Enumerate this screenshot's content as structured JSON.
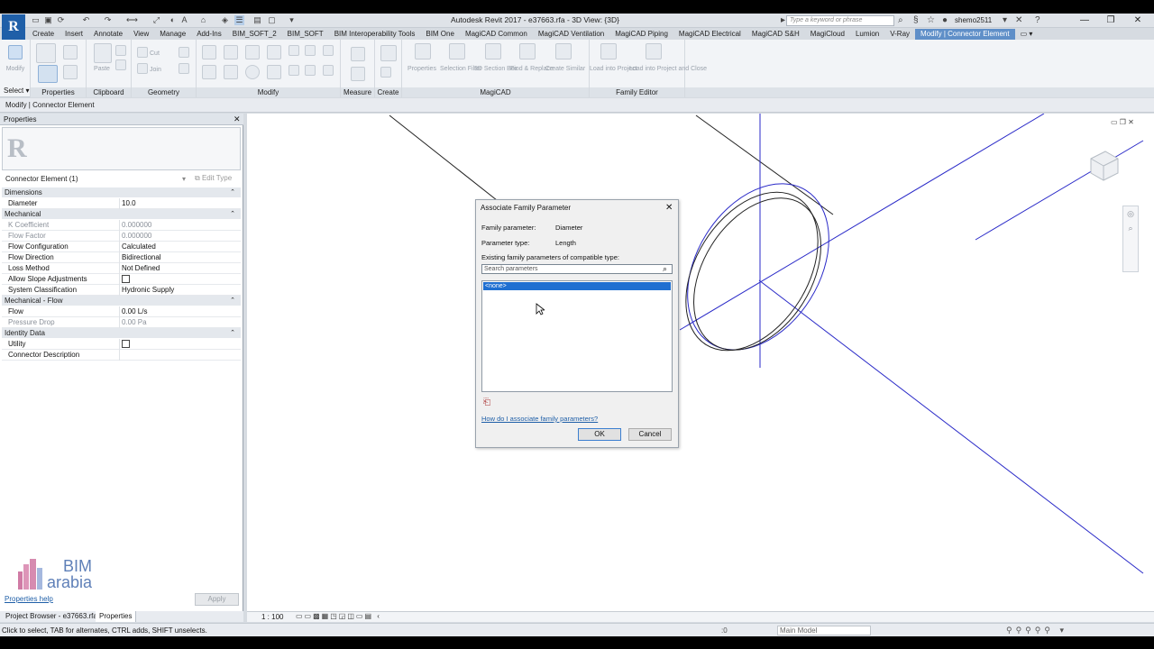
{
  "app": {
    "title": "Autodesk Revit 2017 -   e37663.rfa - 3D View: {3D}",
    "search_placeholder": "Type a keyword or phrase",
    "user": "shemo2511"
  },
  "tabs": [
    "Create",
    "Insert",
    "Annotate",
    "View",
    "Manage",
    "Add-Ins",
    "BIM_SOFT_2",
    "BIM_SOFT",
    "BIM Interoperability Tools",
    "BIM One",
    "MagiCAD Common",
    "MagiCAD Ventilation",
    "MagiCAD Piping",
    "MagiCAD Electrical",
    "MagiCAD S&H",
    "MagiCloud",
    "Lumion",
    "V-Ray",
    "Modify | Connector Element"
  ],
  "active_tab_index": 18,
  "ribbon": {
    "modify_label": "Modify",
    "select_label": "Select",
    "panels": [
      "Properties",
      "Clipboard",
      "Geometry",
      "Modify",
      "Measure",
      "Create",
      "MagiCAD",
      "Family Editor"
    ],
    "clipboard_paste": "Paste",
    "geometry_cut": "Cut",
    "geometry_join": "Join",
    "magicad_items": [
      "Properties",
      "Selection Filter",
      "3D Section Box",
      "Find & Replace",
      "Create Similar"
    ],
    "family_editor_items": [
      "Load into Project",
      "Load into Project and Close"
    ]
  },
  "options_bar": "Modify | Connector Element",
  "properties": {
    "title": "Properties",
    "instance": "Connector Element (1)",
    "edit_type": "Edit Type",
    "groups": [
      {
        "name": "Dimensions",
        "rows": [
          {
            "name": "Diameter",
            "value": "10.0",
            "dim": false
          }
        ]
      },
      {
        "name": "Mechanical",
        "rows": [
          {
            "name": "K Coefficient",
            "value": "0.000000",
            "dim": true
          },
          {
            "name": "Flow Factor",
            "value": "0.000000",
            "dim": true
          },
          {
            "name": "Flow Configuration",
            "value": "Calculated",
            "dim": false
          },
          {
            "name": "Flow Direction",
            "value": "Bidirectional",
            "dim": false
          },
          {
            "name": "Loss Method",
            "value": "Not Defined",
            "dim": false
          },
          {
            "name": "Allow Slope Adjustments",
            "value": "",
            "check": true,
            "dim": false
          },
          {
            "name": "System Classification",
            "value": "Hydronic Supply",
            "dim": false
          }
        ]
      },
      {
        "name": "Mechanical - Flow",
        "rows": [
          {
            "name": "Flow",
            "value": "0.00 L/s",
            "dim": false
          },
          {
            "name": "Pressure Drop",
            "value": "0.00 Pa",
            "dim": true
          }
        ]
      },
      {
        "name": "Identity Data",
        "rows": [
          {
            "name": "Utility",
            "value": "",
            "check": true,
            "dim": false
          },
          {
            "name": "Connector Description",
            "value": "",
            "dim": false
          }
        ]
      }
    ],
    "help_link": "Properties help",
    "apply": "Apply"
  },
  "watermark": {
    "line1": "BIM",
    "line2": "arabia"
  },
  "bottom_tabs": [
    "Project Browser - e37663.rfa",
    "Properties"
  ],
  "view": {
    "scale": "1 : 100"
  },
  "status": {
    "text": "Click to select, TAB for alternates, CTRL adds, SHIFT unselects.",
    "model": "Main Model",
    "zero": ":0"
  },
  "dialog": {
    "title": "Associate Family Parameter",
    "family_parameter_label": "Family parameter:",
    "family_parameter_value": "Diameter",
    "parameter_type_label": "Parameter type:",
    "parameter_type_value": "Length",
    "existing_label": "Existing family parameters of compatible type:",
    "search_placeholder": "Search parameters",
    "list_items": [
      "<none>"
    ],
    "help_link": "How do I associate family parameters?",
    "ok": "OK",
    "cancel": "Cancel"
  }
}
